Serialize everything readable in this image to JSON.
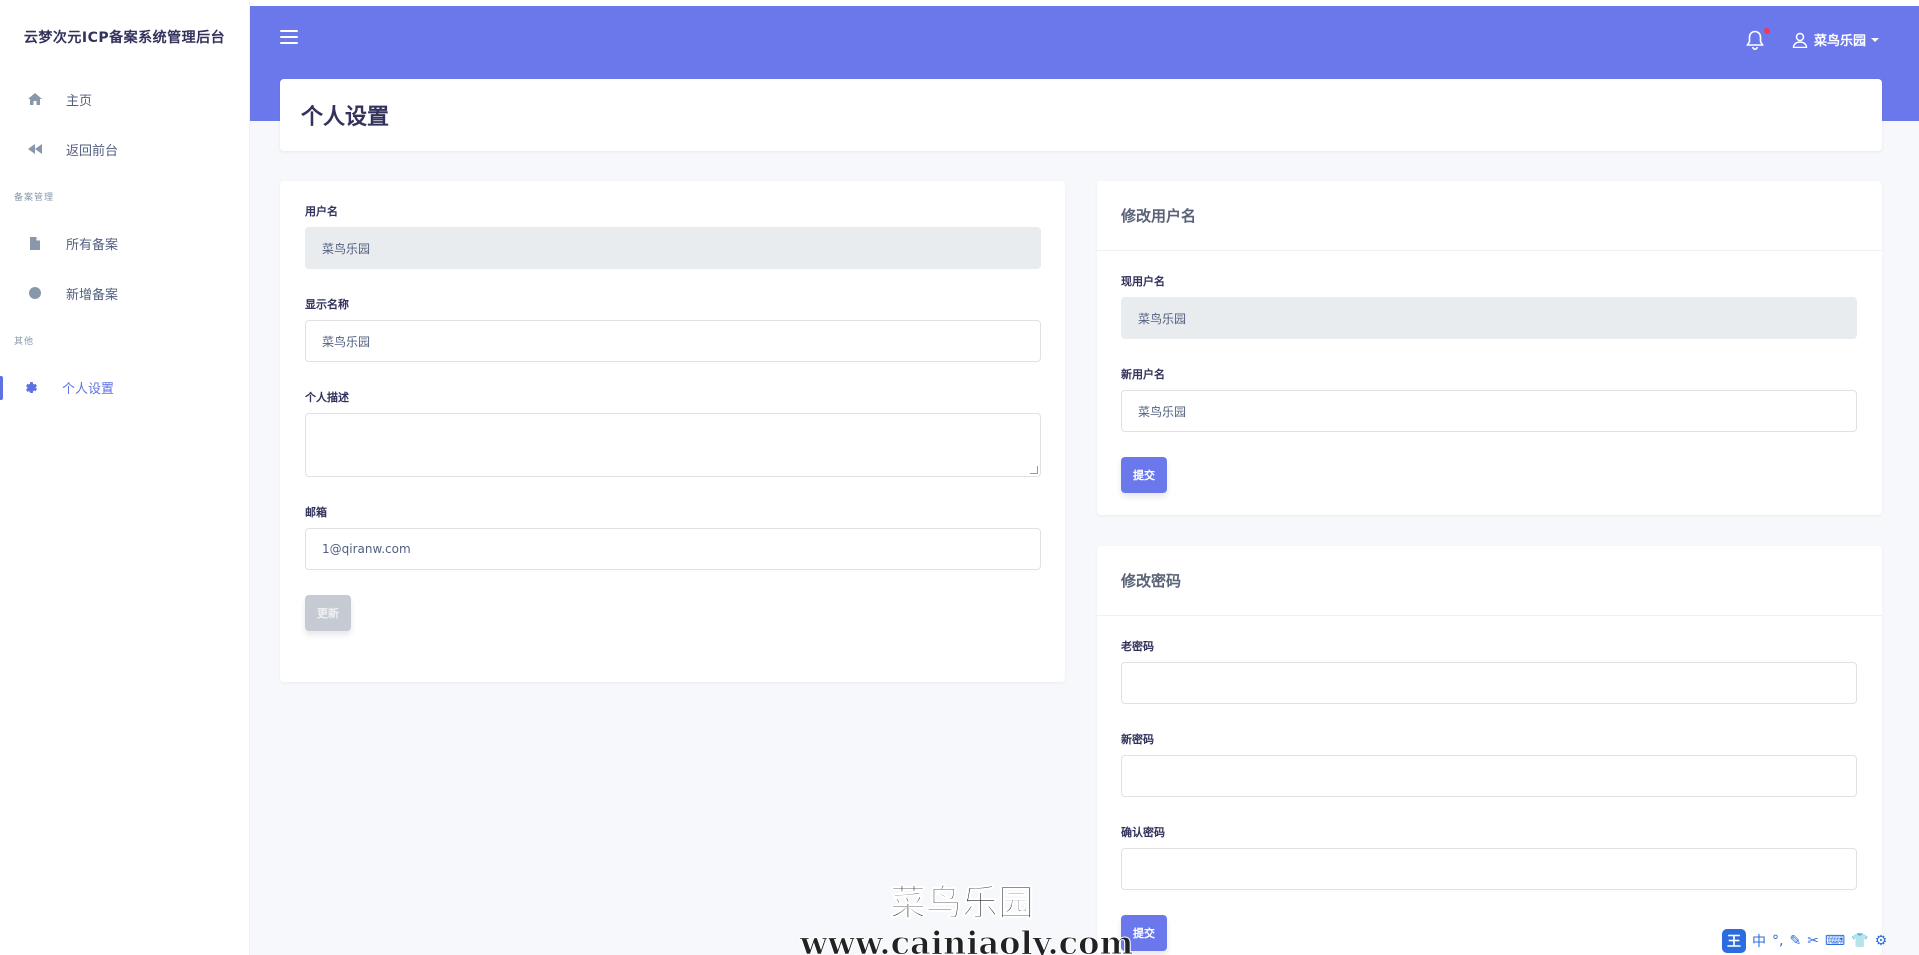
{
  "brand": "云梦次元ICP备案系统管理后台",
  "sidebar": {
    "items": [
      {
        "label": "主页",
        "icon": "home-icon"
      },
      {
        "label": "返回前台",
        "icon": "backward-icon"
      }
    ],
    "section1": "备案管理",
    "items2": [
      {
        "label": "所有备案",
        "icon": "file-icon"
      },
      {
        "label": "新增备案",
        "icon": "circle-icon"
      }
    ],
    "section2": "其他",
    "items3": [
      {
        "label": "个人设置",
        "icon": "gear-icon",
        "active": true
      }
    ]
  },
  "header": {
    "username": "菜鸟乐园",
    "accent": "#6a78eb"
  },
  "page_title": "个人设置",
  "profile_form": {
    "username_label": "用户名",
    "username_value": "菜鸟乐园",
    "display_name_label": "显示名称",
    "display_name_value": "菜鸟乐园",
    "description_label": "个人描述",
    "description_value": "",
    "email_label": "邮箱",
    "email_value": "1@qiranw.com",
    "update_button": "更新"
  },
  "change_username": {
    "title": "修改用户名",
    "current_label": "现用户名",
    "current_value": "菜鸟乐园",
    "new_label": "新用户名",
    "new_value": "菜鸟乐园",
    "submit_button": "提交"
  },
  "change_password": {
    "title": "修改密码",
    "old_label": "老密码",
    "new_label": "新密码",
    "confirm_label": "确认密码",
    "submit_button": "提交"
  },
  "watermark": {
    "line1": "菜鸟乐园",
    "line2": "www.cainiaoly.com"
  },
  "ime": {
    "logo": "王",
    "mode": "中"
  }
}
